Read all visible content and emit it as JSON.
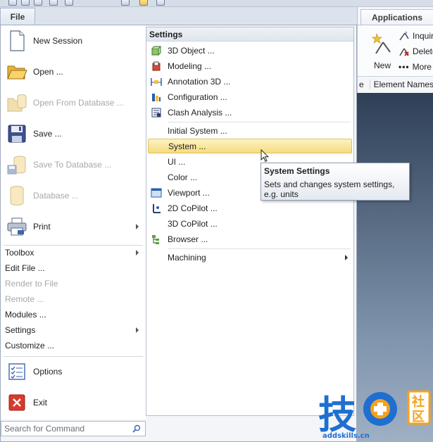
{
  "window": {
    "file_tab": "File"
  },
  "ribbon": {
    "tab": "Applications",
    "new_label": "New",
    "small_items": [
      "Inquiry",
      "Delete",
      "More"
    ],
    "column_header": "Element Names",
    "column_header_left": "e"
  },
  "left_menu": {
    "big_items": [
      {
        "label": "New Session",
        "icon": "new-document-icon",
        "enabled": true
      },
      {
        "label": "Open ...",
        "icon": "open-folder-icon",
        "enabled": true
      },
      {
        "label": "Open From Database ...",
        "icon": "folder-database-icon",
        "enabled": false
      },
      {
        "label": "Save ...",
        "icon": "floppy-disk-icon",
        "enabled": true
      },
      {
        "label": "Save To Database ...",
        "icon": "save-database-icon",
        "enabled": false
      },
      {
        "label": "Database ...",
        "icon": "database-icon",
        "enabled": false
      },
      {
        "label": "Print",
        "icon": "printer-icon",
        "enabled": true,
        "submenu": true
      }
    ],
    "small_items": [
      {
        "label": "Toolbox",
        "enabled": true,
        "submenu": true
      },
      {
        "label": "Edit File ...",
        "enabled": true
      },
      {
        "label": "Render to File",
        "enabled": false
      },
      {
        "label": "Remote ...",
        "enabled": false
      },
      {
        "label": "Modules ...",
        "enabled": true
      },
      {
        "label": "Settings",
        "enabled": true,
        "submenu": true
      },
      {
        "label": "Customize ...",
        "enabled": true
      }
    ],
    "bottom_items": [
      {
        "label": "Options",
        "icon": "checklist-icon"
      },
      {
        "label": "Exit",
        "icon": "exit-icon"
      }
    ],
    "search_placeholder": "Search for Command"
  },
  "settings_menu": {
    "header": "Settings",
    "items": [
      {
        "label": "3D Object ...",
        "icon": "3d-object-icon"
      },
      {
        "label": "Modeling ...",
        "icon": "modeling-icon"
      },
      {
        "label": "Annotation 3D ...",
        "icon": "annotation-icon"
      },
      {
        "label": "Configuration ...",
        "icon": "configuration-icon"
      },
      {
        "label": "Clash Analysis ...",
        "icon": "clash-analysis-icon"
      },
      {
        "label": "Initial System ...",
        "icon": ""
      },
      {
        "label": "System ...",
        "icon": ""
      },
      {
        "label": "UI ...",
        "icon": ""
      },
      {
        "label": "Color ...",
        "icon": ""
      },
      {
        "label": "Viewport ...",
        "icon": "viewport-icon"
      },
      {
        "label": "2D CoPilot ...",
        "icon": "copilot-2d-icon"
      },
      {
        "label": "3D CoPilot ...",
        "icon": ""
      },
      {
        "label": "Browser ...",
        "icon": "browser-tree-icon"
      },
      {
        "label": "Machining",
        "icon": "",
        "submenu": true
      }
    ]
  },
  "tooltip": {
    "title": "System Settings",
    "description": "Sets and changes system settings, e.g. units"
  },
  "watermark": {
    "brand": "技",
    "right_top": "社",
    "right_bottom": "区",
    "url": "addskills.cn"
  }
}
